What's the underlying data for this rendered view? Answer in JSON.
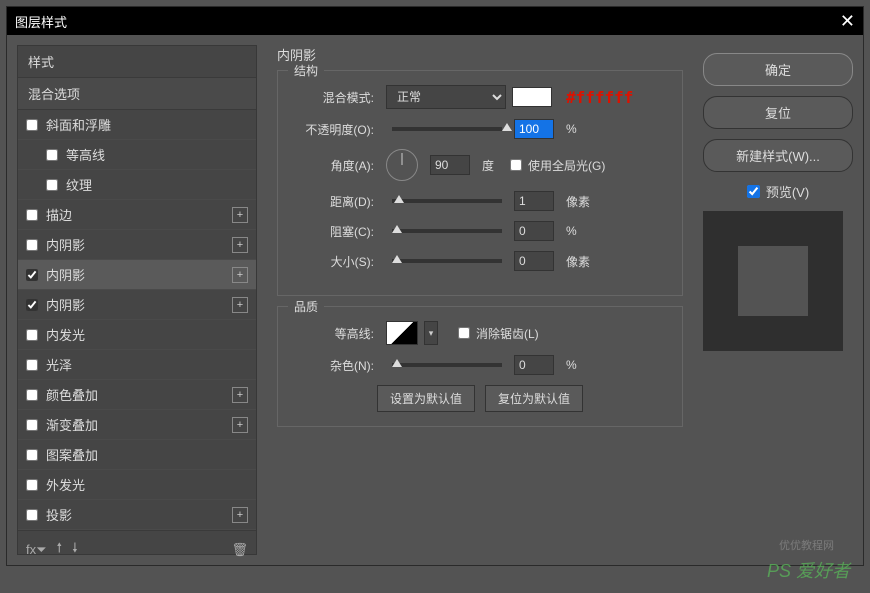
{
  "title": "图层样式",
  "annotation": "#ffffff",
  "left": {
    "header_styles": "样式",
    "header_blend": "混合选项",
    "items": [
      {
        "label": "斜面和浮雕",
        "checked": false,
        "plus": false,
        "indent": false
      },
      {
        "label": "等高线",
        "checked": false,
        "plus": false,
        "indent": true
      },
      {
        "label": "纹理",
        "checked": false,
        "plus": false,
        "indent": true
      },
      {
        "label": "描边",
        "checked": false,
        "plus": true,
        "indent": false
      },
      {
        "label": "内阴影",
        "checked": false,
        "plus": true,
        "indent": false
      },
      {
        "label": "内阴影",
        "checked": true,
        "plus": true,
        "indent": false,
        "selected": true
      },
      {
        "label": "内阴影",
        "checked": true,
        "plus": true,
        "indent": false
      },
      {
        "label": "内发光",
        "checked": false,
        "plus": false,
        "indent": false
      },
      {
        "label": "光泽",
        "checked": false,
        "plus": false,
        "indent": false
      },
      {
        "label": "颜色叠加",
        "checked": false,
        "plus": true,
        "indent": false
      },
      {
        "label": "渐变叠加",
        "checked": false,
        "plus": true,
        "indent": false
      },
      {
        "label": "图案叠加",
        "checked": false,
        "plus": false,
        "indent": false
      },
      {
        "label": "外发光",
        "checked": false,
        "plus": false,
        "indent": false
      },
      {
        "label": "投影",
        "checked": false,
        "plus": true,
        "indent": false
      }
    ]
  },
  "mid": {
    "title": "内阴影",
    "structure_label": "结构",
    "blendmode_label": "混合模式:",
    "blendmode_value": "正常",
    "opacity_label": "不透明度(O):",
    "opacity_value": "100",
    "percent": "%",
    "angle_label": "角度(A):",
    "angle_value": "90",
    "angle_unit": "度",
    "global_light_label": "使用全局光(G)",
    "distance_label": "距离(D):",
    "distance_value": "1",
    "px": "像素",
    "choke_label": "阻塞(C):",
    "choke_value": "0",
    "size_label": "大小(S):",
    "size_value": "0",
    "quality_label": "品质",
    "contour_label": "等高线:",
    "antialias_label": "消除锯齿(L)",
    "noise_label": "杂色(N):",
    "noise_value": "0",
    "make_default": "设置为默认值",
    "reset_default": "复位为默认值"
  },
  "right": {
    "ok": "确定",
    "cancel": "复位",
    "new_style": "新建样式(W)...",
    "preview": "预览(V)"
  },
  "watermark": "PS 爱好者",
  "watermark2": "优优教程网"
}
